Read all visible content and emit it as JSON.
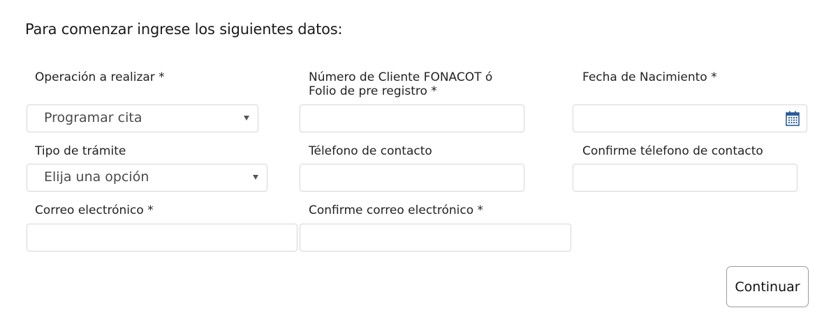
{
  "heading": "Para comenzar ingrese los siguientes datos:",
  "fields": {
    "operacion": {
      "label": "Operación a realizar *",
      "value": "Programar cita"
    },
    "numero_cliente": {
      "label_line1": "Número de Cliente FONACOT ó",
      "label_line2": "Folio de pre registro *",
      "value": ""
    },
    "fecha_nacimiento": {
      "label": "Fecha de Nacimiento *",
      "value": "",
      "icon": "calendar-icon"
    },
    "tipo_tramite": {
      "label": "Tipo de trámite",
      "value": "Elija una opción"
    },
    "telefono": {
      "label": "Télefono de contacto",
      "value": ""
    },
    "confirme_telefono": {
      "label": "Confirme télefono de contacto",
      "value": ""
    },
    "correo": {
      "label": "Correo electrónico *",
      "value": ""
    },
    "confirme_correo": {
      "label": "Confirme correo electrónico *",
      "value": ""
    }
  },
  "actions": {
    "continuar": "Continuar"
  },
  "colors": {
    "border": "#d6d6d6",
    "icon": "#2a5b9a",
    "text": "#222222"
  }
}
